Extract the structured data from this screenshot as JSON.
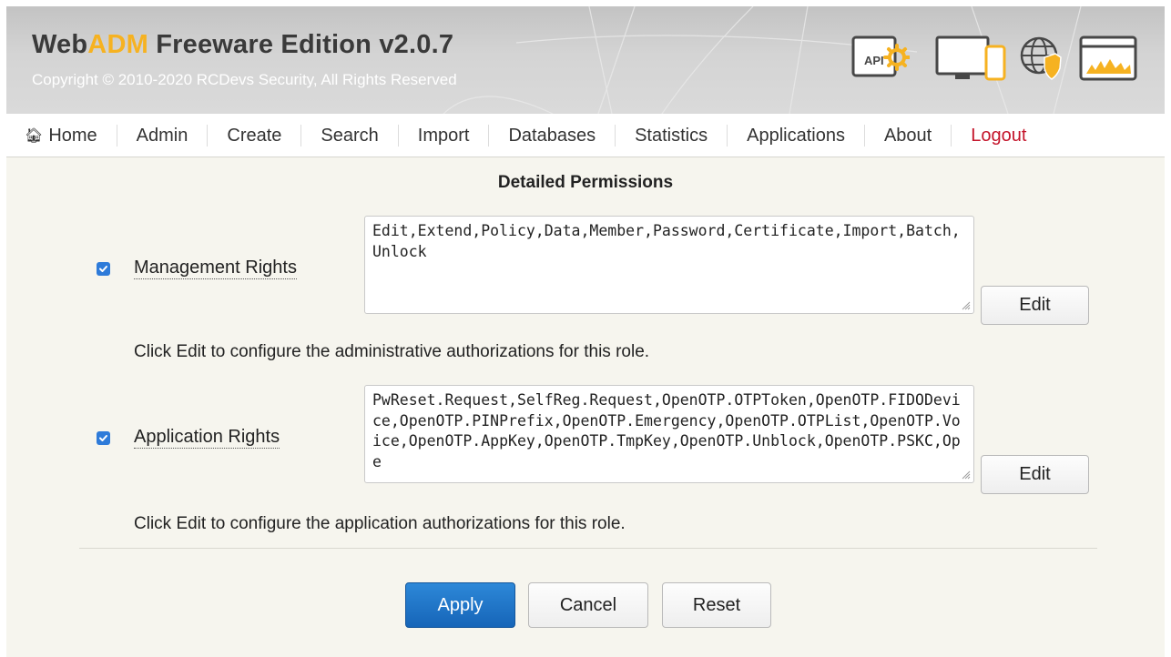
{
  "header": {
    "title_web": "Web",
    "title_adm": "ADM",
    "title_rest": " Freeware Edition v2.0.7",
    "copyright": "Copyright © 2010-2020 RCDevs Security, All Rights Reserved",
    "icons": [
      "api-gear-icon",
      "devices-icon",
      "globe-shield-icon",
      "browser-flame-icon"
    ],
    "api_label": "API"
  },
  "nav": {
    "items": [
      {
        "label": "Home",
        "icon": "home-icon"
      },
      {
        "label": "Admin"
      },
      {
        "label": "Create"
      },
      {
        "label": "Search"
      },
      {
        "label": "Import"
      },
      {
        "label": "Databases"
      },
      {
        "label": "Statistics"
      },
      {
        "label": "Applications"
      },
      {
        "label": "About"
      },
      {
        "label": "Logout"
      }
    ]
  },
  "permissions": {
    "title": "Detailed Permissions",
    "management": {
      "checked": true,
      "label": "Management Rights",
      "value": "Edit,Extend,Policy,Data,Member,Password,Certificate,Import,Batch,Unlock",
      "edit_label": "Edit",
      "help": "Click Edit to configure the administrative authorizations for this role."
    },
    "application": {
      "checked": true,
      "label": "Application Rights",
      "value": "PwReset.Request,SelfReg.Request,OpenOTP.OTPToken,OpenOTP.FIDODevice,OpenOTP.PINPrefix,OpenOTP.Emergency,OpenOTP.OTPList,OpenOTP.Voice,OpenOTP.AppKey,OpenOTP.TmpKey,OpenOTP.Unblock,OpenOTP.PSKC,Ope",
      "edit_label": "Edit",
      "help": "Click Edit to configure the application authorizations for this role."
    }
  },
  "actions": {
    "apply": "Apply",
    "cancel": "Cancel",
    "reset": "Reset"
  },
  "colors": {
    "accent_blue": "#1c6fc4",
    "logout_red": "#c4142a",
    "adm_orange": "#f6b221",
    "header_gray": "#cfcfcf",
    "page_bg": "#f6f5ee"
  }
}
